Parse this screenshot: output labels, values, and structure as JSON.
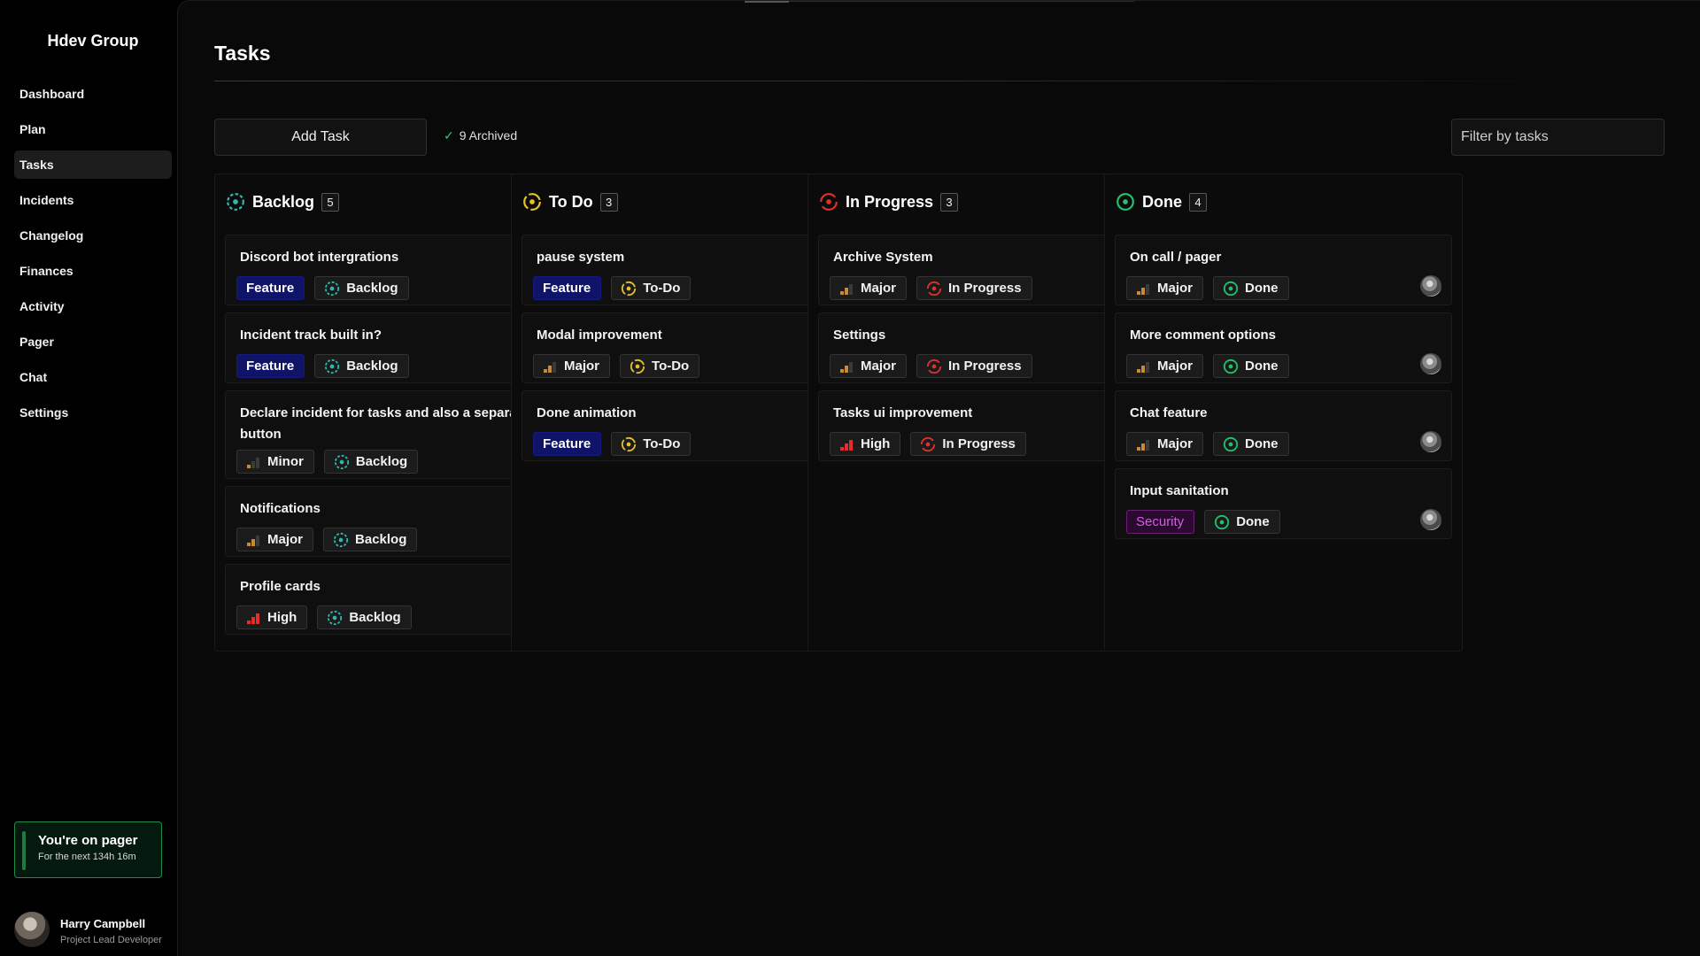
{
  "app": {
    "brand": "Hdev Group"
  },
  "sidebar": {
    "items": [
      {
        "label": "Dashboard",
        "active": false
      },
      {
        "label": "Plan",
        "active": false
      },
      {
        "label": "Tasks",
        "active": true
      },
      {
        "label": "Incidents",
        "active": false
      },
      {
        "label": "Changelog",
        "active": false
      },
      {
        "label": "Finances",
        "active": false
      },
      {
        "label": "Activity",
        "active": false
      },
      {
        "label": "Pager",
        "active": false
      },
      {
        "label": "Chat",
        "active": false
      },
      {
        "label": "Settings",
        "active": false
      }
    ],
    "pager": {
      "title": "You're on pager",
      "subtitle": "For the next 134h 16m"
    },
    "user": {
      "name": "Harry Campbell",
      "role": "Project Lead Developer"
    }
  },
  "page": {
    "title": "Tasks",
    "add_task_label": "Add Task",
    "archived_label": "9 Archived",
    "filter_placeholder": "Filter by tasks"
  },
  "colors": {
    "backlog": "#2fb8b0",
    "todo": "#e6c229",
    "in_progress": "#e0312b",
    "done": "#22c36a",
    "feature": "#0f1468",
    "security": "#d65de5"
  },
  "columns": [
    {
      "key": "backlog",
      "title": "Backlog",
      "count": "5",
      "cards": [
        {
          "title": "Discord bot intergrations",
          "tags": [
            {
              "kind": "feature",
              "label": "Feature"
            },
            {
              "kind": "status",
              "status": "backlog",
              "label": "Backlog"
            }
          ]
        },
        {
          "title": "Incident track built in?",
          "tags": [
            {
              "kind": "feature",
              "label": "Feature"
            },
            {
              "kind": "status",
              "status": "backlog",
              "label": "Backlog"
            }
          ]
        },
        {
          "title": "Declare incident for tasks and also a separate button",
          "tags": [
            {
              "kind": "priority",
              "level": "minor",
              "label": "Minor"
            },
            {
              "kind": "status",
              "status": "backlog",
              "label": "Backlog"
            }
          ]
        },
        {
          "title": "Notifications",
          "tags": [
            {
              "kind": "priority",
              "level": "major",
              "label": "Major"
            },
            {
              "kind": "status",
              "status": "backlog",
              "label": "Backlog"
            }
          ]
        },
        {
          "title": "Profile cards",
          "tags": [
            {
              "kind": "priority",
              "level": "high",
              "label": "High"
            },
            {
              "kind": "status",
              "status": "backlog",
              "label": "Backlog"
            }
          ]
        }
      ]
    },
    {
      "key": "todo",
      "title": "To Do",
      "count": "3",
      "cards": [
        {
          "title": "pause system",
          "tags": [
            {
              "kind": "feature",
              "label": "Feature"
            },
            {
              "kind": "status",
              "status": "todo",
              "label": "To-Do"
            }
          ]
        },
        {
          "title": "Modal improvement",
          "tags": [
            {
              "kind": "priority",
              "level": "major",
              "label": "Major"
            },
            {
              "kind": "status",
              "status": "todo",
              "label": "To-Do"
            }
          ]
        },
        {
          "title": "Done animation",
          "tags": [
            {
              "kind": "feature",
              "label": "Feature"
            },
            {
              "kind": "status",
              "status": "todo",
              "label": "To-Do"
            }
          ]
        }
      ]
    },
    {
      "key": "in_progress",
      "title": "In Progress",
      "count": "3",
      "cards": [
        {
          "title": "Archive System",
          "tags": [
            {
              "kind": "priority",
              "level": "major",
              "label": "Major"
            },
            {
              "kind": "status",
              "status": "in_progress",
              "label": "In Progress"
            }
          ]
        },
        {
          "title": "Settings",
          "tags": [
            {
              "kind": "priority",
              "level": "major",
              "label": "Major"
            },
            {
              "kind": "status",
              "status": "in_progress",
              "label": "In Progress"
            }
          ]
        },
        {
          "title": "Tasks ui improvement",
          "tags": [
            {
              "kind": "priority",
              "level": "high",
              "label": "High"
            },
            {
              "kind": "status",
              "status": "in_progress",
              "label": "In Progress"
            }
          ]
        }
      ]
    },
    {
      "key": "done",
      "title": "Done",
      "count": "4",
      "cards": [
        {
          "title": "On call / pager",
          "tags": [
            {
              "kind": "priority",
              "level": "major",
              "label": "Major"
            },
            {
              "kind": "status",
              "status": "done",
              "label": "Done"
            }
          ]
        },
        {
          "title": "More comment options",
          "tags": [
            {
              "kind": "priority",
              "level": "major",
              "label": "Major"
            },
            {
              "kind": "status",
              "status": "done",
              "label": "Done"
            }
          ]
        },
        {
          "title": "Chat feature",
          "tags": [
            {
              "kind": "priority",
              "level": "major",
              "label": "Major"
            },
            {
              "kind": "status",
              "status": "done",
              "label": "Done"
            }
          ]
        },
        {
          "title": "Input sanitation",
          "tags": [
            {
              "kind": "security",
              "label": "Security"
            },
            {
              "kind": "status",
              "status": "done",
              "label": "Done"
            }
          ]
        }
      ]
    }
  ]
}
